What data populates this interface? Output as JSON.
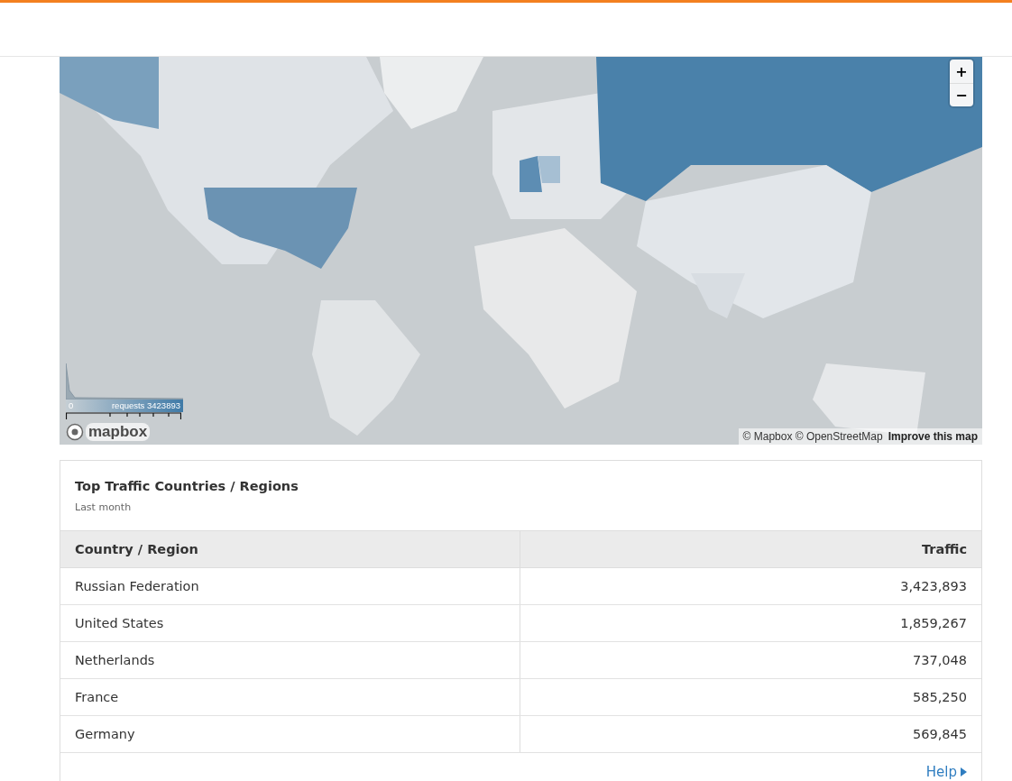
{
  "map": {
    "zoom_in": "+",
    "zoom_out": "−",
    "legend": {
      "min": "0",
      "max": "requests 3423893"
    },
    "logo": "mapbox",
    "attribution": "© Mapbox © OpenStreetMap",
    "improve_link": "Improve this map"
  },
  "card": {
    "title": "Top Traffic Countries / Regions",
    "subtitle": "Last month",
    "table": {
      "columns": [
        "Country / Region",
        "Traffic"
      ],
      "rows": [
        [
          "Russian Federation",
          "3,423,893"
        ],
        [
          "United States",
          "1,859,267"
        ],
        [
          "Netherlands",
          "737,048"
        ],
        [
          "France",
          "585,250"
        ],
        [
          "Germany",
          "569,845"
        ]
      ]
    },
    "help_link": "Help"
  }
}
